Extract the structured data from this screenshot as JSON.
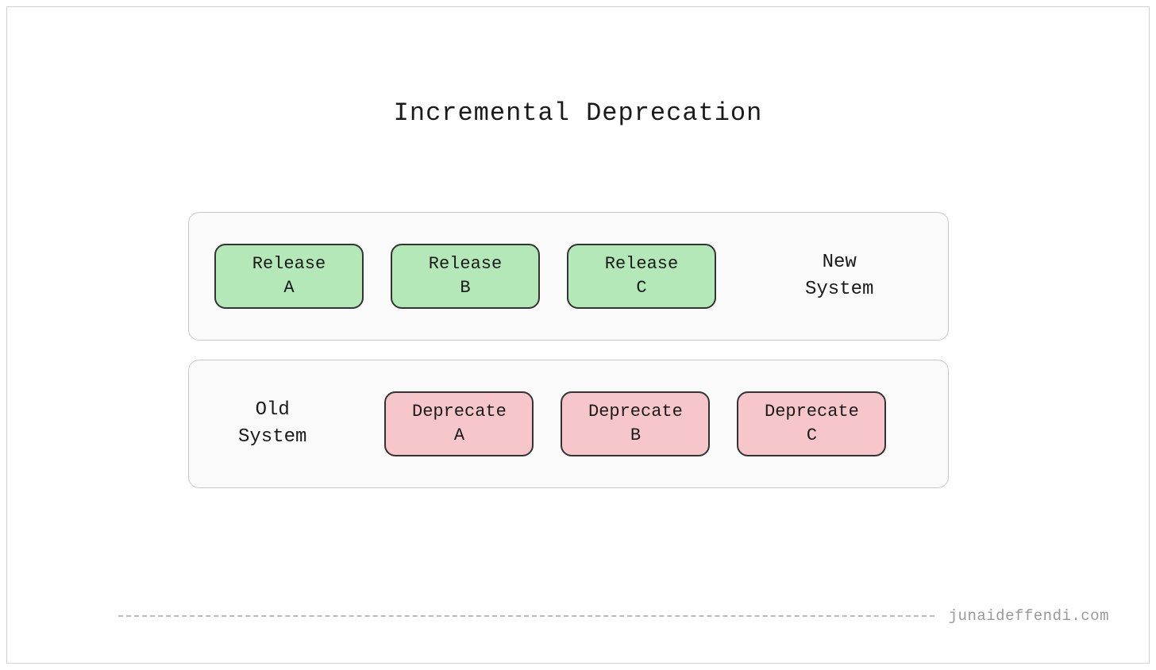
{
  "title": "Incremental Deprecation",
  "new_system": {
    "label_line1": "New",
    "label_line2": "System",
    "items": [
      {
        "line1": "Release",
        "line2": "A"
      },
      {
        "line1": "Release",
        "line2": "B"
      },
      {
        "line1": "Release",
        "line2": "C"
      }
    ]
  },
  "old_system": {
    "label_line1": "Old",
    "label_line2": "System",
    "items": [
      {
        "line1": "Deprecate",
        "line2": "A"
      },
      {
        "line1": "Deprecate",
        "line2": "B"
      },
      {
        "line1": "Deprecate",
        "line2": "C"
      }
    ]
  },
  "attribution": "junaideffendi.com",
  "colors": {
    "release_bg": "#b4e8b8",
    "deprecate_bg": "#f7c6cb",
    "box_bg": "#fafafa",
    "border": "#c8c8c8"
  }
}
